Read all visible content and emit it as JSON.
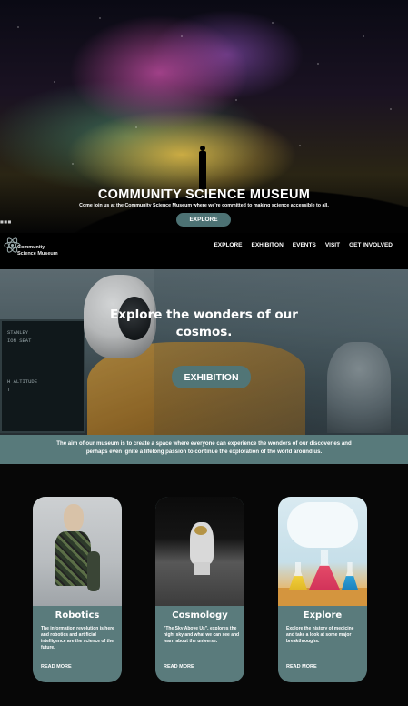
{
  "hero": {
    "title": "COMMUNITY SCIENCE MUSEUM",
    "subtitle": "Come join us at the Community Science Museum where we're committed to making science accessible to all.",
    "button_label": "EXPLORE"
  },
  "nav": {
    "logo_line1": "Community",
    "logo_line2": "Science Museum",
    "links": [
      "EXPLORE",
      "EXHIBITON",
      "EVENTS",
      "VISIT",
      "GET INVOLVED"
    ]
  },
  "feature": {
    "title_line1": "Explore the wonders of our",
    "title_line2": "cosmos.",
    "button_label": "EXHIBITION",
    "screen_lines": [
      "STANLEY",
      "ION SEAT",
      "",
      "",
      "",
      "",
      "H ALTITUDE",
      "T"
    ]
  },
  "mission": {
    "line1": "The aim of our museum is to create a space where everyone can experience the wonders of our discoveries and",
    "line2": "perhaps even ignite a lifelong passion to continue the exploration of the world around us."
  },
  "cards": [
    {
      "title": "Robotics",
      "desc": "The information revolution is here and robotics and artificial intelligence are the science of the future.",
      "more": "READ MORE",
      "icon": "robot-image"
    },
    {
      "title": "Cosmology",
      "desc": "\"The Sky Above Us\", explores the night sky and what we can see and learn about the universe.",
      "more": "READ MORE",
      "icon": "moon-astronaut-image"
    },
    {
      "title": "Explore",
      "desc": "Explore the history of medicine and take a look at some major breakthroughs.",
      "more": "READ MORE",
      "icon": "lab-flasks-image"
    }
  ],
  "colors": {
    "accent": "#587a7b",
    "background": "#070707"
  }
}
